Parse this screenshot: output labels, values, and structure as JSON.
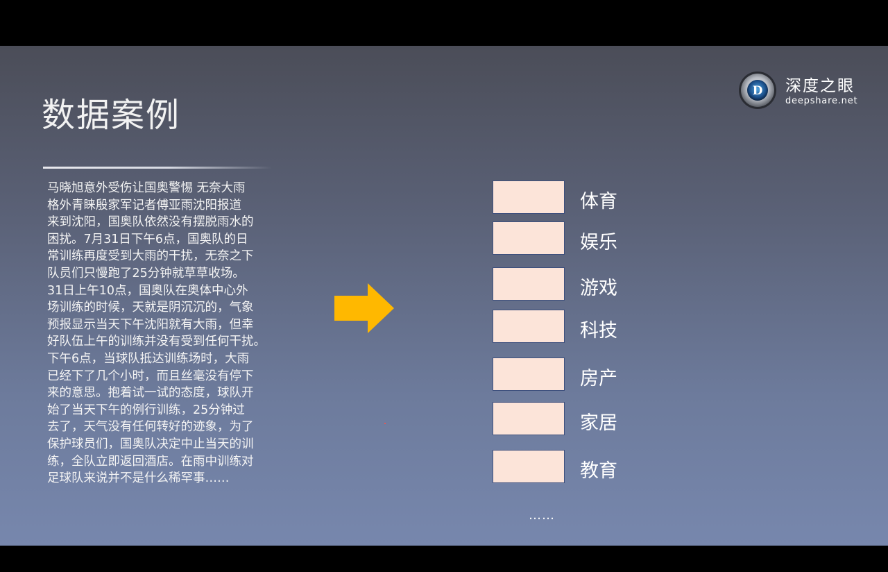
{
  "slide": {
    "title": "数据案例",
    "article_lines": [
      "马晓旭意外受伤让国奥警惕 无奈大雨",
      "格外青睐殷家军记者傅亚雨沈阳报道",
      "来到沈阳，国奥队依然没有摆脱雨水的",
      "困扰。7月31日下午6点，国奥队的日",
      "常训练再度受到大雨的干扰，无奈之下",
      "队员们只慢跑了25分钟就草草收场。",
      "31日上午10点，国奥队在奥体中心外",
      "场训练的时候，天就是阴沉沉的，气象",
      "预报显示当天下午沈阳就有大雨，但幸",
      "好队伍上午的训练并没有受到任何干扰。",
      "下午6点，当球队抵达训练场时，大雨",
      "已经下了几个小时，而且丝毫没有停下",
      "来的意思。抱着试一试的态度，球队开",
      "始了当天下午的例行训练，25分钟过",
      "去了，天气没有任何转好的迹象，为了",
      "保护球员们，国奥队决定中止当天的训",
      "练，全队立即返回酒店。在雨中训练对",
      "足球队来说并不是什么稀罕事……"
    ],
    "arrow_icon": "right-arrow-icon",
    "categories": [
      "体育",
      "娱乐",
      "游戏",
      "科技",
      "房产",
      "家居",
      "教育"
    ],
    "more": "……"
  },
  "logo": {
    "name": "深度之眼",
    "url": "deepshare.net",
    "emblem_letter": "D"
  },
  "colors": {
    "arrow": "#ffb800",
    "box_fill": "#fce4d9",
    "box_border": "#3d4f7d",
    "text": "#ffffff"
  }
}
